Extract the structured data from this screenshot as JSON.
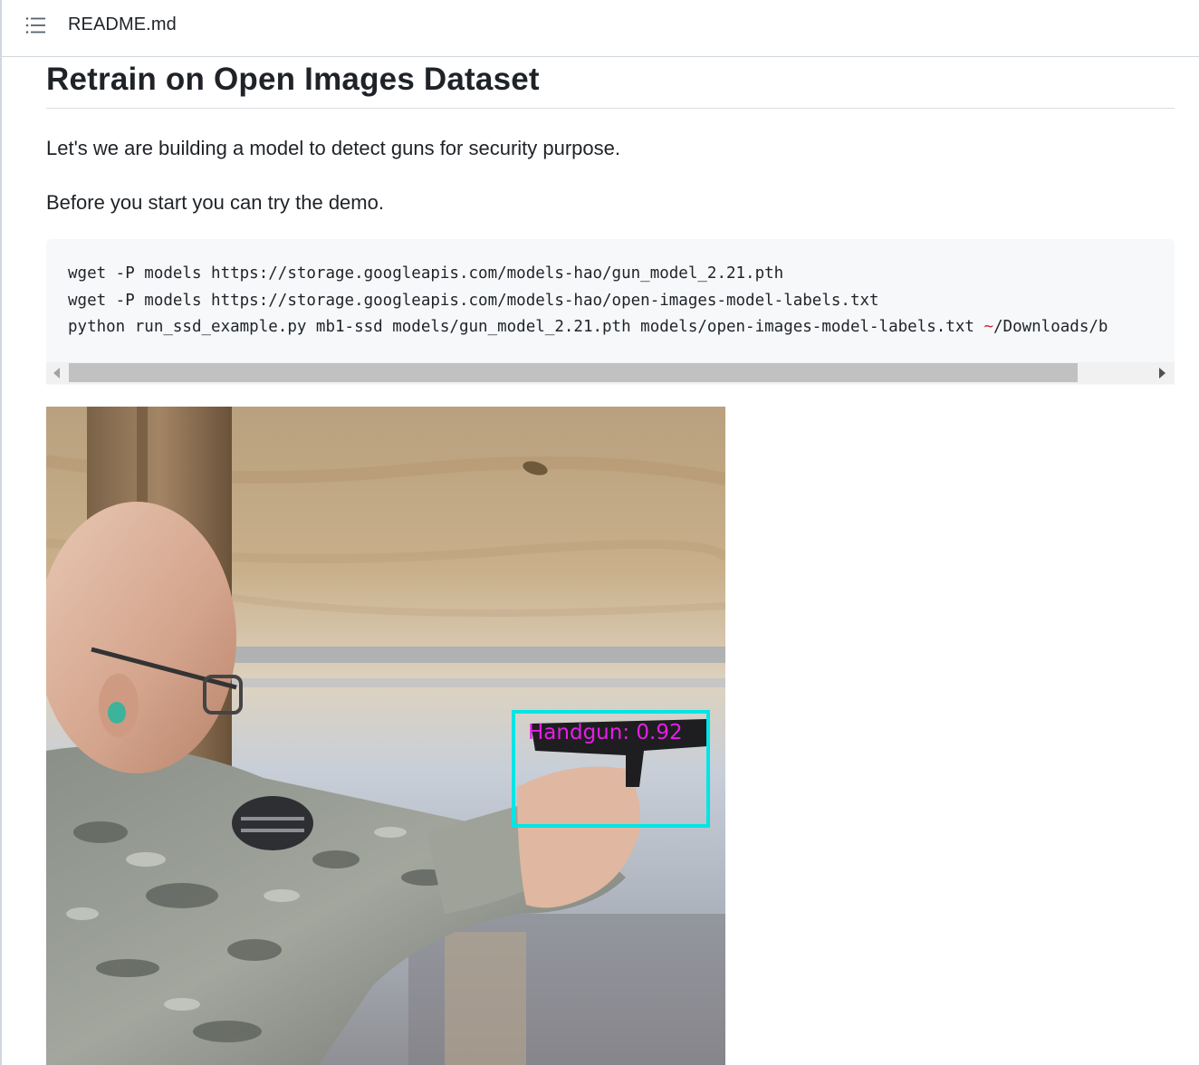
{
  "header": {
    "toc_icon": "list-unordered-icon",
    "filename": "README.md"
  },
  "article": {
    "heading": "Retrain on Open Images Dataset",
    "paragraph_1": "Let's we are building a model to detect guns for security purpose.",
    "paragraph_2": "Before you start you can try the demo.",
    "code": {
      "line_1": "wget -P models https://storage.googleapis.com/models-hao/gun_model_2.21.pth",
      "line_2": "wget -P models https://storage.googleapis.com/models-hao/open-images-model-labels.txt",
      "line_3_before": "python run_ssd_example.py mb1-ssd models/gun_model_2.21.pth models/open-images-model-labels.txt ",
      "line_3_tilde": "~",
      "line_3_after": "/Downloads/b"
    },
    "image": {
      "detection_label": "Handgun: 0.92",
      "box_color": "#00e5e5",
      "label_color": "#e61ee6"
    }
  }
}
